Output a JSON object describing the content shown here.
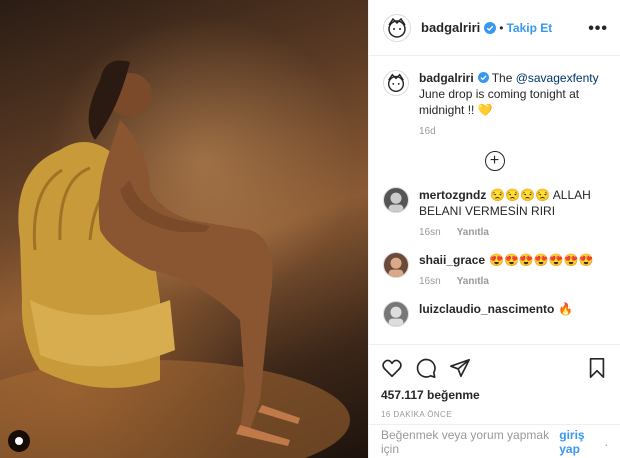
{
  "post": {
    "username": "badgalriri",
    "follow_label": "Takip Et",
    "dot": "•",
    "more": "•••"
  },
  "caption": {
    "username": "badgalriri",
    "text_pre": "The ",
    "mention": "@savagexfenty",
    "text_post": " June drop is coming tonight at midnight !! 💛",
    "time": "16d"
  },
  "load_more_symbol": "+",
  "comments": [
    {
      "username": "mertozgndz",
      "text": "😒😒😒😒 ALLAH BELANI VERMESİN RIRI",
      "time": "16sn",
      "reply": "Yanıtla"
    },
    {
      "username": "shaii_grace",
      "text": "😍😍😍😍😍😍😍",
      "time": "16sn",
      "reply": "Yanıtla"
    },
    {
      "username": "luizclaudio_nascimento",
      "text": "🔥",
      "time": "",
      "reply": ""
    }
  ],
  "actions": {
    "icons": [
      "heart-icon",
      "comment-icon",
      "share-icon",
      "bookmark-icon"
    ],
    "likes": "457.117 beğenme",
    "time_ago": "16 DAKİKA ÖNCE"
  },
  "footer": {
    "prompt": "Beğenmek veya yorum yapmak için",
    "login": "giriş yap",
    "period": "."
  },
  "colors": {
    "link": "#3897f0",
    "mention": "#003569",
    "muted": "#999999",
    "border": "#efefef"
  }
}
